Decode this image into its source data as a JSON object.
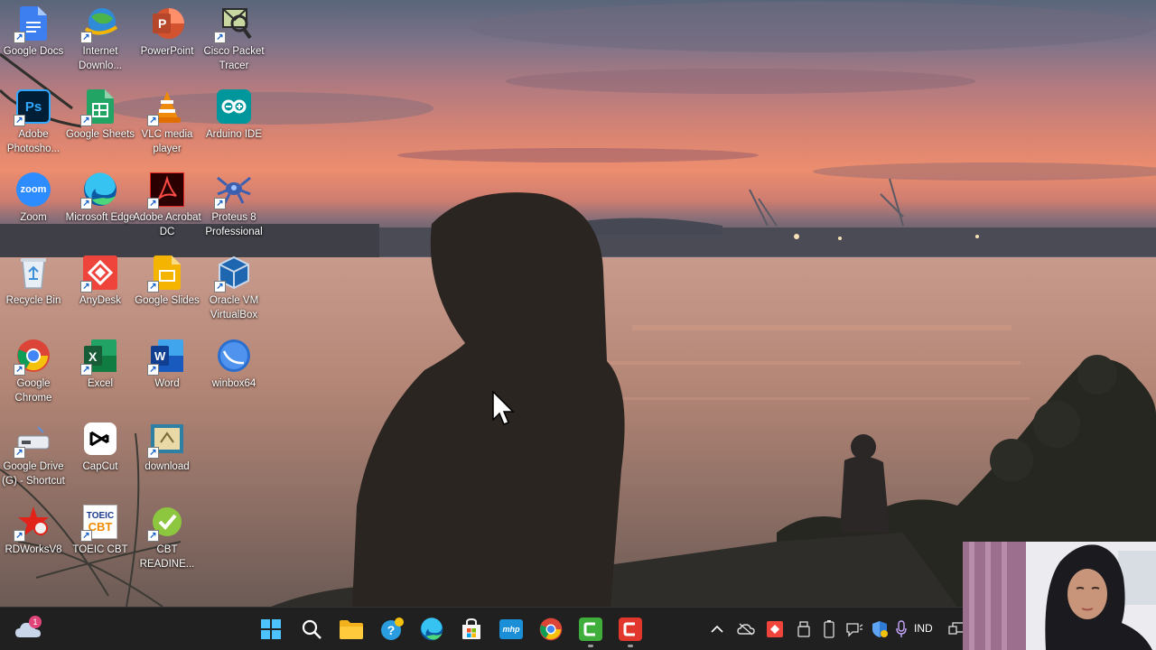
{
  "desktop_icons": [
    {
      "label": "Google Docs",
      "icon": "google-docs-icon"
    },
    {
      "label": "Internet Downlo...",
      "icon": "internet-download-manager-icon"
    },
    {
      "label": "PowerPoint",
      "icon": "powerpoint-icon"
    },
    {
      "label": "Cisco Packet Tracer",
      "icon": "cisco-packet-tracer-icon"
    },
    {
      "label": "Adobe Photosho...",
      "icon": "photoshop-icon"
    },
    {
      "label": "Google Sheets",
      "icon": "google-sheets-icon"
    },
    {
      "label": "VLC media player",
      "icon": "vlc-icon"
    },
    {
      "label": "Arduino IDE",
      "icon": "arduino-icon"
    },
    {
      "label": "Zoom",
      "icon": "zoom-icon"
    },
    {
      "label": "Microsoft Edge",
      "icon": "edge-icon"
    },
    {
      "label": "Adobe Acrobat DC",
      "icon": "acrobat-icon"
    },
    {
      "label": "Proteus 8 Professional",
      "icon": "proteus-icon"
    },
    {
      "label": "Recycle Bin",
      "icon": "recycle-bin-icon"
    },
    {
      "label": "AnyDesk",
      "icon": "anydesk-icon"
    },
    {
      "label": "Google Slides",
      "icon": "google-slides-icon"
    },
    {
      "label": "Oracle VM VirtualBox",
      "icon": "virtualbox-icon"
    },
    {
      "label": "Google Chrome",
      "icon": "chrome-icon"
    },
    {
      "label": "Excel",
      "icon": "excel-icon"
    },
    {
      "label": "Word",
      "icon": "word-icon"
    },
    {
      "label": "winbox64",
      "icon": "winbox-icon"
    },
    {
      "label": "Google Drive (G) - Shortcut",
      "icon": "google-drive-icon"
    },
    {
      "label": "CapCut",
      "icon": "capcut-icon"
    },
    {
      "label": "download",
      "icon": "download-folder-icon"
    },
    {
      "label": "RDWorksV8",
      "icon": "rdworks-icon"
    },
    {
      "label": "TOEIC CBT",
      "icon": "toeic-cbt-icon"
    },
    {
      "label": "CBT READINE...",
      "icon": "cbt-readiness-icon"
    }
  ],
  "icon_text": {
    "powerpoint": "P",
    "photoshop": "Ps",
    "zoom": "zoom",
    "excel": "X",
    "word": "W",
    "toeic_line1": "TOEIC",
    "toeic_line2": "CBT"
  },
  "weather_badge": "1",
  "taskbar_apps": [
    {
      "name": "start",
      "icon": "windows-start-icon"
    },
    {
      "name": "search",
      "icon": "search-icon"
    },
    {
      "name": "file-explorer",
      "icon": "folder-icon"
    },
    {
      "name": "help",
      "icon": "help-icon"
    },
    {
      "name": "edge",
      "icon": "edge-icon"
    },
    {
      "name": "store",
      "icon": "microsoft-store-icon"
    },
    {
      "name": "mhp",
      "icon": "mhp-icon"
    },
    {
      "name": "chrome",
      "icon": "chrome-icon"
    },
    {
      "name": "camtasia-recorder",
      "icon": "camtasia-green-icon"
    },
    {
      "name": "camtasia",
      "icon": "camtasia-red-icon"
    }
  ],
  "mhp_label": "mhp",
  "tray": {
    "language": "IND"
  }
}
